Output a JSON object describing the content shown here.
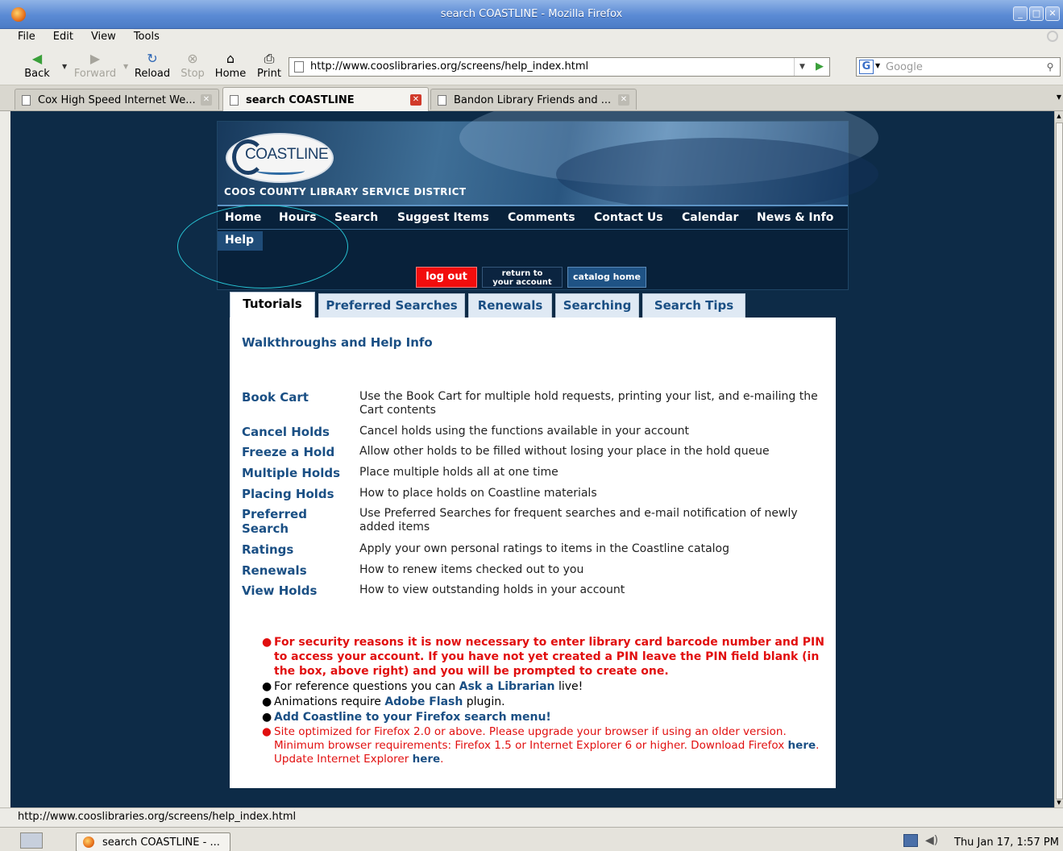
{
  "window": {
    "title": "search COASTLINE - Mozilla Firefox"
  },
  "menubar": {
    "items": [
      "File",
      "Edit",
      "View",
      "Tools"
    ]
  },
  "toolbar": {
    "back": "Back",
    "forward": "Forward",
    "reload": "Reload",
    "stop": "Stop",
    "home": "Home",
    "print": "Print",
    "url": "http://www.cooslibraries.org/screens/help_index.html",
    "search_placeholder": "Google"
  },
  "tabs": [
    {
      "label": "Cox High Speed Internet We...",
      "active": false
    },
    {
      "label": "search COASTLINE",
      "active": true
    },
    {
      "label": "Bandon Library Friends and ...",
      "active": false
    }
  ],
  "site": {
    "logo": "COASTLINE",
    "district": "COOS COUNTY LIBRARY SERVICE DISTRICT",
    "nav": [
      "Home",
      "Hours",
      "Search",
      "Suggest Items",
      "Comments",
      "Contact Us",
      "Calendar",
      "News & Info"
    ],
    "help": "Help",
    "logout": "log out",
    "return_line1": "return to",
    "return_line2": "your account",
    "catalog_home": "catalog home"
  },
  "page_tabs": [
    {
      "label": "Tutorials",
      "active": true
    },
    {
      "label": "Preferred Searches",
      "active": false
    },
    {
      "label": "Renewals",
      "active": false
    },
    {
      "label": "Searching",
      "active": false
    },
    {
      "label": "Search Tips",
      "active": false
    }
  ],
  "panel": {
    "heading": "Walkthroughs and Help Info",
    "tutorials": [
      {
        "name": "Book Cart",
        "desc": "Use the Book Cart for multiple hold requests, printing your list, and e-mailing the Cart contents"
      },
      {
        "name": "Cancel Holds",
        "desc": "Cancel holds using the functions available in your account"
      },
      {
        "name": "Freeze a Hold",
        "desc": "Allow other holds to be filled without losing your place in the hold queue"
      },
      {
        "name": "Multiple Holds",
        "desc": "Place multiple holds all at one time"
      },
      {
        "name": "Placing Holds",
        "desc": "How to place holds on Coastline materials"
      },
      {
        "name": "Preferred Search",
        "desc": "Use Preferred Searches for frequent searches and e-mail notification of newly added items"
      },
      {
        "name": "Ratings",
        "desc": "Apply your own personal ratings to items in the Coastline catalog"
      },
      {
        "name": "Renewals",
        "desc": "How to renew items checked out to you"
      },
      {
        "name": "View Holds",
        "desc": "How to view outstanding holds in your account"
      }
    ],
    "notes": {
      "security": "For security reasons it is now necessary to enter library card barcode number and PIN to access your account. If you have not yet created a PIN leave the PIN field blank (in the box, above right) and you will be prompted to create one.",
      "reference_pre": "For reference questions you can ",
      "reference_link": "Ask a Librarian",
      "reference_post": " live!",
      "flash_pre": "Animations require ",
      "flash_link": "Adobe Flash",
      "flash_post": " plugin.",
      "firefox_search": "Add Coastline to your Firefox search menu!",
      "optimized_pre": "Site optimized for Firefox 2.0 or above. Please upgrade your browser if using an older version. Minimum browser requirements: Firefox 1.5 or Internet Explorer 6 or higher.  Download Firefox ",
      "optimized_link1": "here",
      "optimized_mid": ".  Update Internet Explorer ",
      "optimized_link2": "here",
      "optimized_post": "."
    }
  },
  "statusbar": {
    "text": "http://www.cooslibraries.org/screens/help_index.html"
  },
  "taskbar": {
    "window_label": "search COASTLINE - ...",
    "clock": "Thu Jan 17,  1:57 PM"
  },
  "colors": {
    "page_bg": "#0d2b47",
    "link": "#1a4f84",
    "alert": "#e10f0f",
    "logout": "#f20d0d",
    "highlight_ring": "#27c3d3"
  }
}
